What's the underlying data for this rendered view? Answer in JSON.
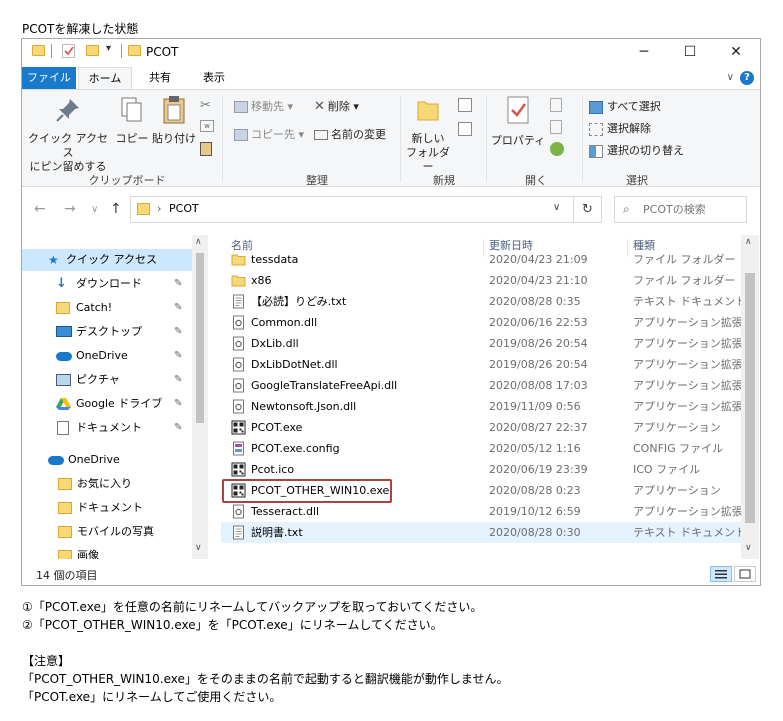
{
  "caption": "PCOTを解凍した状態",
  "window": {
    "title": "PCOT",
    "tabs": {
      "file": "ファイル",
      "home": "ホーム",
      "share": "共有",
      "view": "表示"
    },
    "controls": {
      "minimize": "─",
      "maximize": "☐",
      "close": "✕"
    }
  },
  "ribbon": {
    "clipboard": {
      "pin": "クイック アクセス\nにピン留めする",
      "copy": "コピー",
      "paste": "貼り付け",
      "label": "クリップボード"
    },
    "organize": {
      "move": "移動先",
      "copyto": "コピー先",
      "delete": "削除",
      "rename": "名前の変更",
      "label": "整理"
    },
    "new": {
      "folder": "新しい\nフォルダー",
      "label": "新規"
    },
    "open": {
      "properties": "プロパティ",
      "label": "開く"
    },
    "select": {
      "all": "すべて選択",
      "none": "選択解除",
      "invert": "選択の切り替え",
      "label": "選択"
    }
  },
  "address": {
    "path": "PCOT",
    "search_placeholder": "PCOTの検索"
  },
  "nav": {
    "quick_access": "クイック アクセス",
    "items": [
      {
        "label": "ダウンロード",
        "icon": "download-icon",
        "pinned": true
      },
      {
        "label": "Catch!",
        "icon": "folder-icon",
        "pinned": true
      },
      {
        "label": "デスクトップ",
        "icon": "desktop-icon",
        "pinned": true
      },
      {
        "label": "OneDrive",
        "icon": "cloud-icon",
        "pinned": true
      },
      {
        "label": "ピクチャ",
        "icon": "pictures-icon",
        "pinned": true
      },
      {
        "label": "Google ドライブ",
        "icon": "google-drive-icon",
        "pinned": true
      },
      {
        "label": "ドキュメント",
        "icon": "documents-icon",
        "pinned": true
      }
    ],
    "onedrive": "OneDrive",
    "onedrive_items": [
      {
        "label": "お気に入り"
      },
      {
        "label": "ドキュメント"
      },
      {
        "label": "モバイルの写真"
      },
      {
        "label": "画像"
      }
    ]
  },
  "columns": {
    "name": "名前",
    "date": "更新日時",
    "type": "種類"
  },
  "files": [
    {
      "name": "tessdata",
      "date": "2020/04/23 21:09",
      "type": "ファイル フォルダー",
      "icon": "folder"
    },
    {
      "name": "x86",
      "date": "2020/04/23 21:10",
      "type": "ファイル フォルダー",
      "icon": "folder"
    },
    {
      "name": "【必読】りどみ.txt",
      "date": "2020/08/28 0:35",
      "type": "テキスト ドキュメント",
      "icon": "text"
    },
    {
      "name": "Common.dll",
      "date": "2020/06/16 22:53",
      "type": "アプリケーション拡張",
      "icon": "dll"
    },
    {
      "name": "DxLib.dll",
      "date": "2019/08/26 20:54",
      "type": "アプリケーション拡張",
      "icon": "dll"
    },
    {
      "name": "DxLibDotNet.dll",
      "date": "2019/08/26 20:54",
      "type": "アプリケーション拡張",
      "icon": "dll"
    },
    {
      "name": "GoogleTranslateFreeApi.dll",
      "date": "2020/08/08 17:03",
      "type": "アプリケーション拡張",
      "icon": "dll"
    },
    {
      "name": "Newtonsoft.Json.dll",
      "date": "2019/11/09 0:56",
      "type": "アプリケーション拡張",
      "icon": "dll"
    },
    {
      "name": "PCOT.exe",
      "date": "2020/08/27 22:37",
      "type": "アプリケーション",
      "icon": "app"
    },
    {
      "name": "PCOT.exe.config",
      "date": "2020/05/12 1:16",
      "type": "CONFIG ファイル",
      "icon": "config"
    },
    {
      "name": "Pcot.ico",
      "date": "2020/06/19 23:39",
      "type": "ICO ファイル",
      "icon": "app"
    },
    {
      "name": "PCOT_OTHER_WIN10.exe",
      "date": "2020/08/28 0:23",
      "type": "アプリケーション",
      "icon": "app"
    },
    {
      "name": "Tesseract.dll",
      "date": "2019/10/12 6:59",
      "type": "アプリケーション拡張",
      "icon": "dll"
    },
    {
      "name": "説明書.txt",
      "date": "2020/08/28 0:30",
      "type": "テキスト ドキュメント",
      "icon": "text"
    }
  ],
  "status": "14 個の項目",
  "instructions": {
    "line1": "①「PCOT.exe」を任意の名前にリネームしてバックアップを取っておいてください。",
    "line2": "②「PCOT_OTHER_WIN10.exe」を「PCOT.exe」にリネームしてください。",
    "note_head": "【注意】",
    "line3": "「PCOT_OTHER_WIN10.exe」をそのままの名前で起動すると翻訳機能が動作しません。",
    "line4": "「PCOT.exe」にリネームしてご使用ください。"
  },
  "colors": {
    "accent": "#1979ca",
    "highlight": "#a94442",
    "selection": "#cce8ff"
  }
}
